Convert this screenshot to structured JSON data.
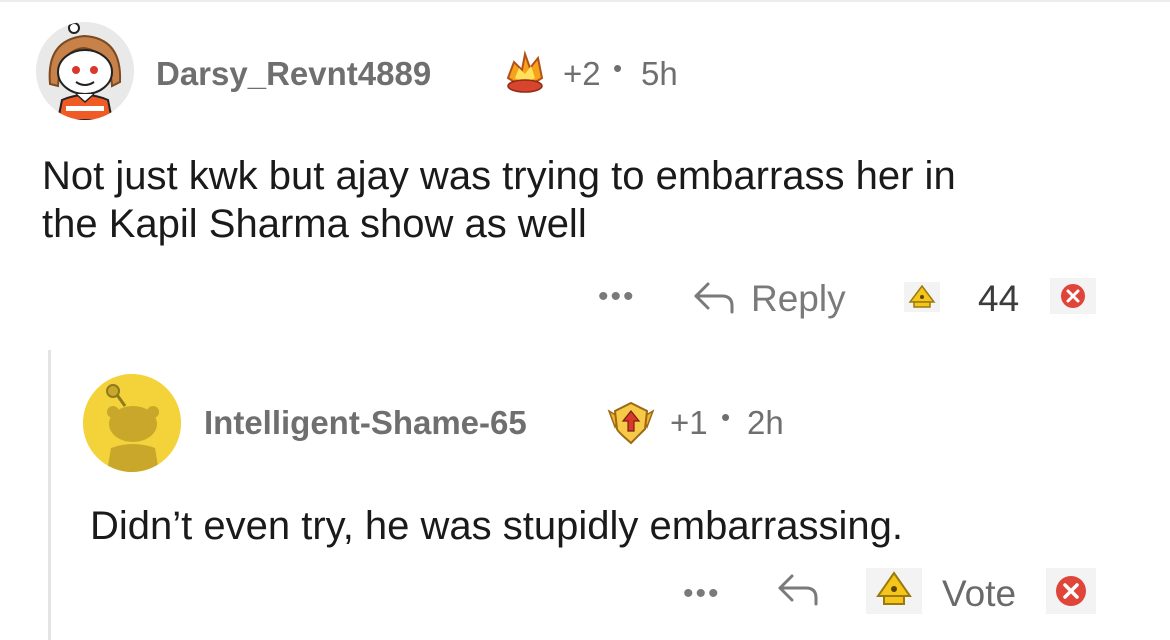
{
  "comment1": {
    "username": "Darsy_Revnt4889",
    "award_count": "+2",
    "separator": "•",
    "time": "5h",
    "text_line1": "Not just kwk but ajay was trying to embarrass her in",
    "text_line2": "the Kapil Sharma show as well",
    "more": "•••",
    "reply_label": "Reply",
    "score": "44",
    "avatar_icon": "snoo-avatar-girl",
    "award_icon": "fire-crystal-award-icon"
  },
  "comment2": {
    "username": "Intelligent-Shame-65",
    "award_count": "+1",
    "separator": "•",
    "time": "2h",
    "text": "Didn’t even try, he was stupidly embarrassing.",
    "more": "•••",
    "vote_label": "Vote",
    "avatar_icon": "snoo-avatar-default",
    "award_icon": "rank-up-shield-award-icon"
  },
  "colors": {
    "meta_gray": "#6f6f6f",
    "upvote_yellow": "#f5c518",
    "downvote_red": "#e0453a",
    "avatar2_bg": "#f3d23a",
    "thread_line": "#e4e4e4"
  }
}
